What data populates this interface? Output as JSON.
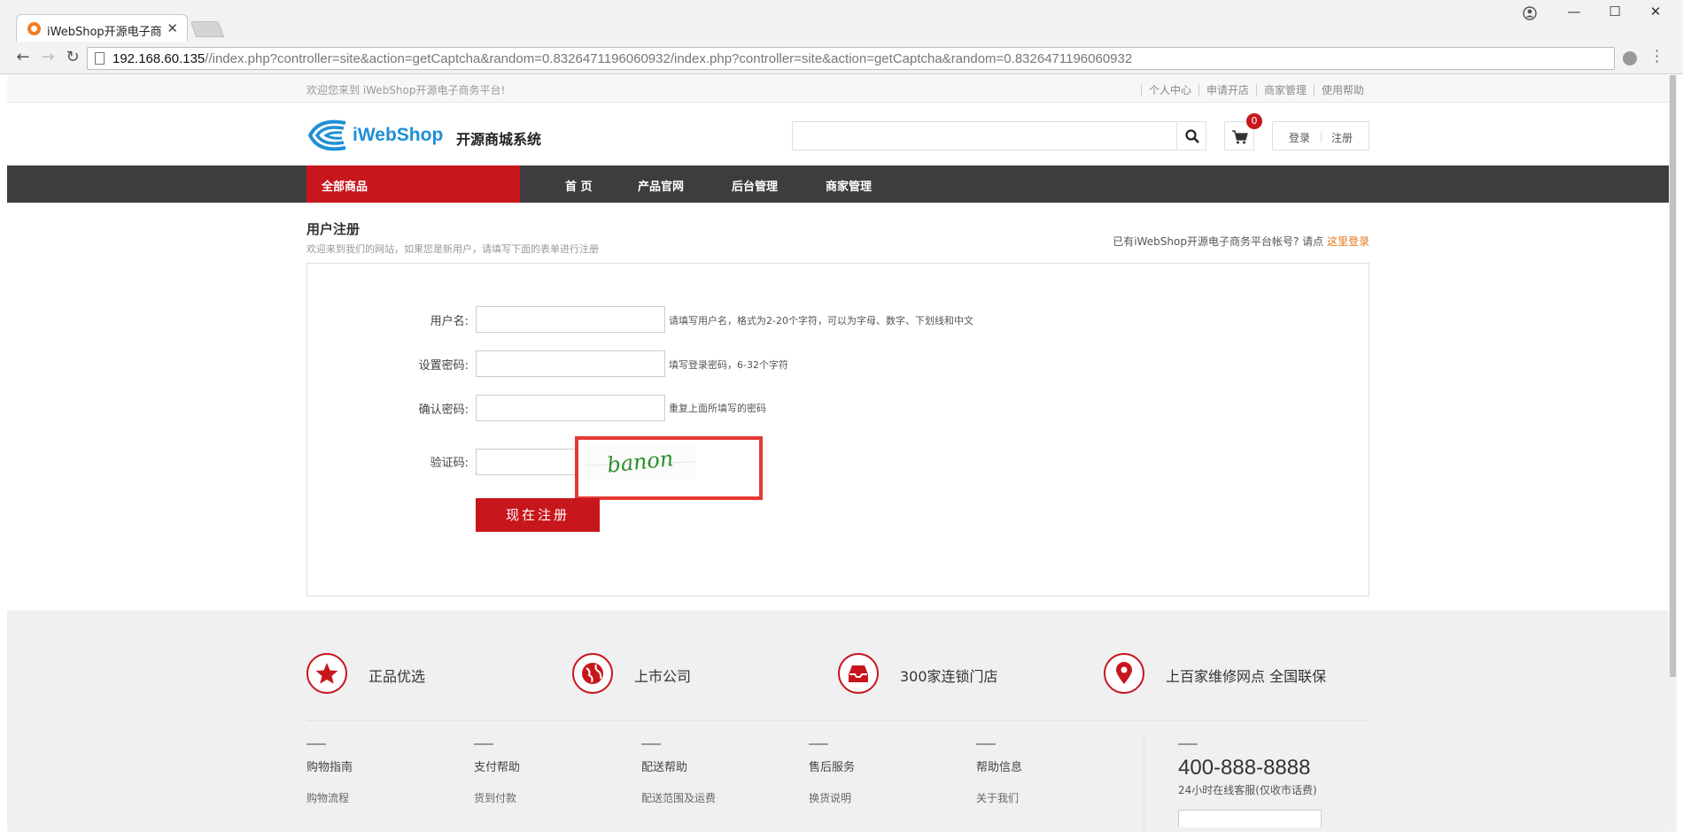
{
  "browser": {
    "tab_title": "iWebShop开源电子商务",
    "tab_close": "✕",
    "url_host": "192.168.60.135",
    "url_path": "//index.php?controller=site&action=getCaptcha&random=0.8326471196060932/index.php?controller=site&action=getCaptcha&random=0.8326471196060932",
    "window_controls": {
      "minimize": "—",
      "maximize": "☐",
      "close": "✕"
    },
    "nav": {
      "back": "←",
      "forward": "→",
      "reload": "↻"
    }
  },
  "site": {
    "welcome": "欢迎您来到 iWebShop开源电子商务平台!",
    "top_links": [
      "个人中心",
      "申请开店",
      "商家管理",
      "使用帮助"
    ],
    "logo_brand": "iWebShop",
    "logo_sub": "开源商城系统",
    "search_placeholder": "",
    "cart_count": "0",
    "login": "登录",
    "register": "注册",
    "all_categories": "全部商品",
    "nav_items": [
      "首 页",
      "产品官网",
      "后台管理",
      "商家管理"
    ]
  },
  "register": {
    "title": "用户注册",
    "subtitle": "欢迎来到我们的网站，如果您是新用户，请填写下面的表单进行注册",
    "have_account": "已有iWebShop开源电子商务平台帐号? 请点",
    "login_here": "这里登录",
    "fields": [
      {
        "label": "用户名:",
        "value": "",
        "hint": "请填写用户名，格式为2-20个字符，可以为字母、数字、下划线和中文"
      },
      {
        "label": "设置密码:",
        "value": "",
        "hint": "填写登录密码，6-32个字符"
      },
      {
        "label": "确认密码:",
        "value": "",
        "hint": "重复上面所填写的密码"
      }
    ],
    "captcha_label": "验证码:",
    "captcha_text": "banon",
    "submit": "现在注册"
  },
  "footer": {
    "features": [
      "正品优选",
      "上市公司",
      "300家连锁门店",
      "上百家维修网点 全国联保"
    ],
    "feature_icons": [
      "star-icon",
      "globe-icon",
      "inbox-icon",
      "location-pin-icon"
    ],
    "columns": [
      {
        "head": "购物指南",
        "link": "购物流程"
      },
      {
        "head": "支付帮助",
        "link": "货到付款"
      },
      {
        "head": "配送帮助",
        "link": "配送范围及运费"
      },
      {
        "head": "售后服务",
        "link": "换货说明"
      },
      {
        "head": "帮助信息",
        "link": "关于我们"
      }
    ],
    "hotline": "400-888-8888",
    "hotline_desc": "24小时在线客服(仅收市话费)"
  },
  "colors": {
    "accent": "#c8161d",
    "nav_bg": "#3d3d3d",
    "link_orange": "#e4761b",
    "brand_blue": "#1f8fd6",
    "captcha_green": "#2a8f2a",
    "highlight_red": "#e53935"
  }
}
